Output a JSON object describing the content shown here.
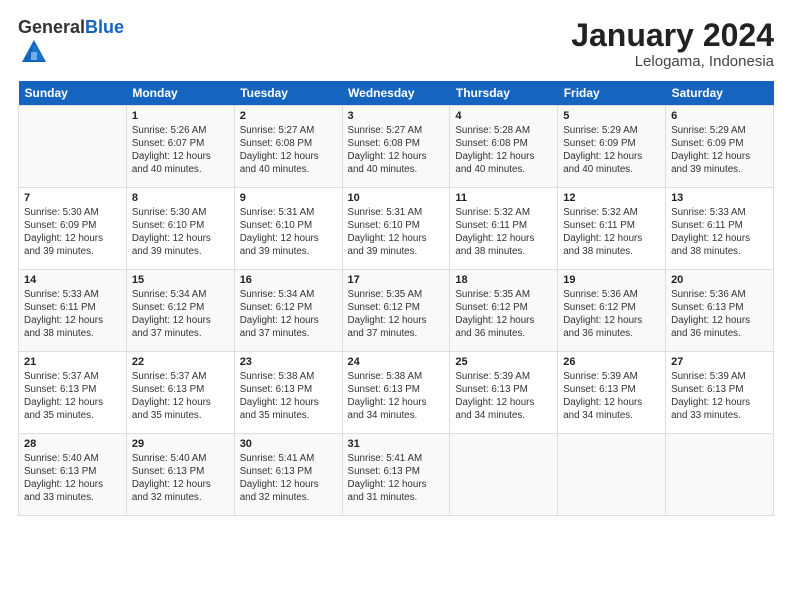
{
  "logo": {
    "general": "General",
    "blue": "Blue"
  },
  "header": {
    "title": "January 2024",
    "subtitle": "Lelogama, Indonesia"
  },
  "columns": [
    "Sunday",
    "Monday",
    "Tuesday",
    "Wednesday",
    "Thursday",
    "Friday",
    "Saturday"
  ],
  "weeks": [
    [
      {
        "day": "",
        "text": ""
      },
      {
        "day": "1",
        "text": "Sunrise: 5:26 AM\nSunset: 6:07 PM\nDaylight: 12 hours and 40 minutes."
      },
      {
        "day": "2",
        "text": "Sunrise: 5:27 AM\nSunset: 6:08 PM\nDaylight: 12 hours and 40 minutes."
      },
      {
        "day": "3",
        "text": "Sunrise: 5:27 AM\nSunset: 6:08 PM\nDaylight: 12 hours and 40 minutes."
      },
      {
        "day": "4",
        "text": "Sunrise: 5:28 AM\nSunset: 6:08 PM\nDaylight: 12 hours and 40 minutes."
      },
      {
        "day": "5",
        "text": "Sunrise: 5:29 AM\nSunset: 6:09 PM\nDaylight: 12 hours and 40 minutes."
      },
      {
        "day": "6",
        "text": "Sunrise: 5:29 AM\nSunset: 6:09 PM\nDaylight: 12 hours and 39 minutes."
      }
    ],
    [
      {
        "day": "7",
        "text": "Sunrise: 5:30 AM\nSunset: 6:09 PM\nDaylight: 12 hours and 39 minutes."
      },
      {
        "day": "8",
        "text": "Sunrise: 5:30 AM\nSunset: 6:10 PM\nDaylight: 12 hours and 39 minutes."
      },
      {
        "day": "9",
        "text": "Sunrise: 5:31 AM\nSunset: 6:10 PM\nDaylight: 12 hours and 39 minutes."
      },
      {
        "day": "10",
        "text": "Sunrise: 5:31 AM\nSunset: 6:10 PM\nDaylight: 12 hours and 39 minutes."
      },
      {
        "day": "11",
        "text": "Sunrise: 5:32 AM\nSunset: 6:11 PM\nDaylight: 12 hours and 38 minutes."
      },
      {
        "day": "12",
        "text": "Sunrise: 5:32 AM\nSunset: 6:11 PM\nDaylight: 12 hours and 38 minutes."
      },
      {
        "day": "13",
        "text": "Sunrise: 5:33 AM\nSunset: 6:11 PM\nDaylight: 12 hours and 38 minutes."
      }
    ],
    [
      {
        "day": "14",
        "text": "Sunrise: 5:33 AM\nSunset: 6:11 PM\nDaylight: 12 hours and 38 minutes."
      },
      {
        "day": "15",
        "text": "Sunrise: 5:34 AM\nSunset: 6:12 PM\nDaylight: 12 hours and 37 minutes."
      },
      {
        "day": "16",
        "text": "Sunrise: 5:34 AM\nSunset: 6:12 PM\nDaylight: 12 hours and 37 minutes."
      },
      {
        "day": "17",
        "text": "Sunrise: 5:35 AM\nSunset: 6:12 PM\nDaylight: 12 hours and 37 minutes."
      },
      {
        "day": "18",
        "text": "Sunrise: 5:35 AM\nSunset: 6:12 PM\nDaylight: 12 hours and 36 minutes."
      },
      {
        "day": "19",
        "text": "Sunrise: 5:36 AM\nSunset: 6:12 PM\nDaylight: 12 hours and 36 minutes."
      },
      {
        "day": "20",
        "text": "Sunrise: 5:36 AM\nSunset: 6:13 PM\nDaylight: 12 hours and 36 minutes."
      }
    ],
    [
      {
        "day": "21",
        "text": "Sunrise: 5:37 AM\nSunset: 6:13 PM\nDaylight: 12 hours and 35 minutes."
      },
      {
        "day": "22",
        "text": "Sunrise: 5:37 AM\nSunset: 6:13 PM\nDaylight: 12 hours and 35 minutes."
      },
      {
        "day": "23",
        "text": "Sunrise: 5:38 AM\nSunset: 6:13 PM\nDaylight: 12 hours and 35 minutes."
      },
      {
        "day": "24",
        "text": "Sunrise: 5:38 AM\nSunset: 6:13 PM\nDaylight: 12 hours and 34 minutes."
      },
      {
        "day": "25",
        "text": "Sunrise: 5:39 AM\nSunset: 6:13 PM\nDaylight: 12 hours and 34 minutes."
      },
      {
        "day": "26",
        "text": "Sunrise: 5:39 AM\nSunset: 6:13 PM\nDaylight: 12 hours and 34 minutes."
      },
      {
        "day": "27",
        "text": "Sunrise: 5:39 AM\nSunset: 6:13 PM\nDaylight: 12 hours and 33 minutes."
      }
    ],
    [
      {
        "day": "28",
        "text": "Sunrise: 5:40 AM\nSunset: 6:13 PM\nDaylight: 12 hours and 33 minutes."
      },
      {
        "day": "29",
        "text": "Sunrise: 5:40 AM\nSunset: 6:13 PM\nDaylight: 12 hours and 32 minutes."
      },
      {
        "day": "30",
        "text": "Sunrise: 5:41 AM\nSunset: 6:13 PM\nDaylight: 12 hours and 32 minutes."
      },
      {
        "day": "31",
        "text": "Sunrise: 5:41 AM\nSunset: 6:13 PM\nDaylight: 12 hours and 31 minutes."
      },
      {
        "day": "",
        "text": ""
      },
      {
        "day": "",
        "text": ""
      },
      {
        "day": "",
        "text": ""
      }
    ]
  ]
}
